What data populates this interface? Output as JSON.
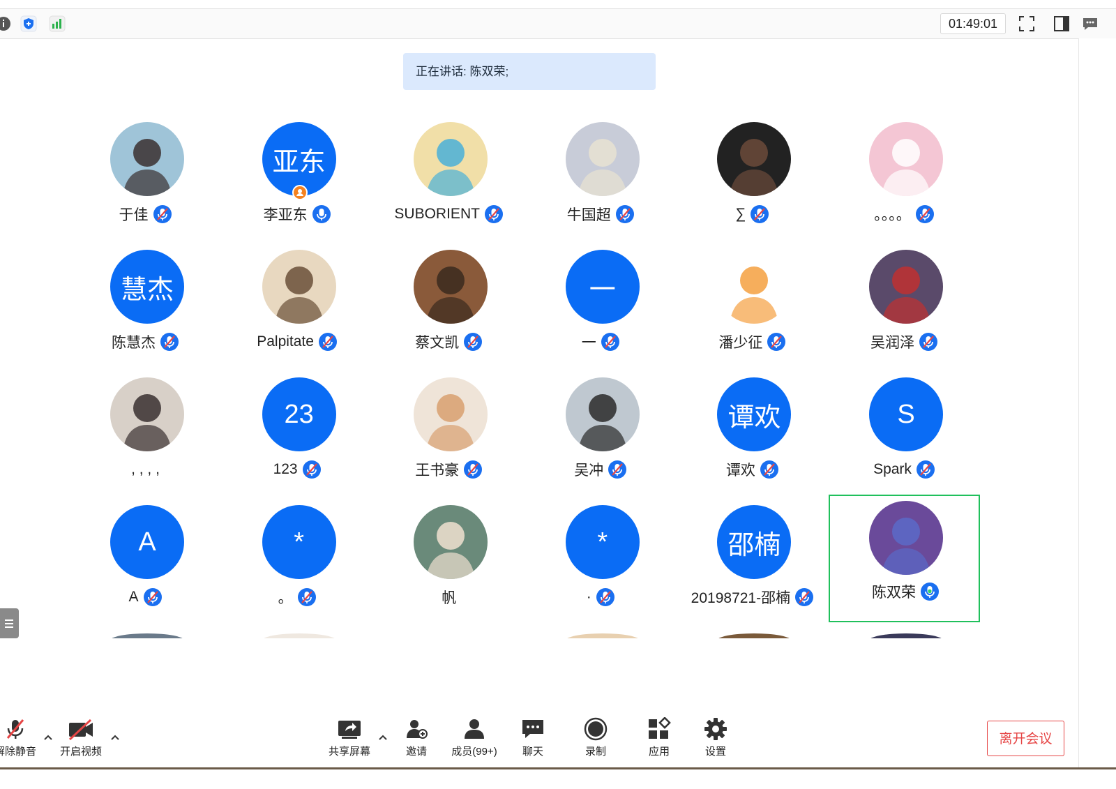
{
  "topbar": {
    "timer": "01:49:01",
    "icons": [
      "info-icon",
      "security-shield-icon",
      "signal-strength-icon",
      "fullscreen-icon",
      "side-panel-icon",
      "chat-bubble-icon"
    ]
  },
  "speaker_banner": "正在讲话: 陈双荣;",
  "participants": [
    {
      "name": "于佳",
      "avatar": "photo",
      "mic": "muted"
    },
    {
      "name": "李亚东",
      "avatar": "亚东",
      "mic": "unmuted",
      "host": true
    },
    {
      "name": "SUBORIENT",
      "avatar": "photo",
      "mic": "muted"
    },
    {
      "name": "牛国超",
      "avatar": "photo",
      "mic": "muted"
    },
    {
      "name": "∑",
      "avatar": "photo",
      "mic": "muted"
    },
    {
      "name": "。。。。",
      "avatar": "photo",
      "mic": "muted"
    },
    {
      "name": "陈慧杰",
      "avatar": "慧杰",
      "mic": "muted"
    },
    {
      "name": "Palpitate",
      "avatar": "photo",
      "mic": "muted"
    },
    {
      "name": "蔡文凯",
      "avatar": "photo",
      "mic": "muted"
    },
    {
      "name": "一",
      "avatar": "一",
      "mic": "muted"
    },
    {
      "name": "潘少征",
      "avatar": "photo",
      "mic": "muted"
    },
    {
      "name": "吴润泽",
      "avatar": "photo",
      "mic": "muted"
    },
    {
      "name": ", , , ,",
      "avatar": "photo",
      "mic": "none"
    },
    {
      "name": "123",
      "avatar": "23",
      "mic": "muted"
    },
    {
      "name": "王书豪",
      "avatar": "photo",
      "mic": "muted"
    },
    {
      "name": "吴冲",
      "avatar": "photo",
      "mic": "muted"
    },
    {
      "name": "谭欢",
      "avatar": "谭欢",
      "mic": "muted"
    },
    {
      "name": "Spark",
      "avatar": "S",
      "mic": "muted"
    },
    {
      "name": "A",
      "avatar": "A",
      "mic": "muted"
    },
    {
      "name": "。",
      "avatar": "*",
      "mic": "muted"
    },
    {
      "name": "帆",
      "avatar": "photo",
      "mic": "none"
    },
    {
      "name": "·",
      "avatar": "*",
      "mic": "muted"
    },
    {
      "name": "20198721-邵楠",
      "avatar": "邵楠",
      "mic": "muted"
    },
    {
      "name": "陈双荣",
      "avatar": "photo",
      "mic": "speaking",
      "active": true
    }
  ],
  "toolbar": {
    "unmute": "解除静音",
    "start_video": "开启视频",
    "share_screen": "共享屏幕",
    "invite": "邀请",
    "members": "成员(99+)",
    "chat": "聊天",
    "record": "录制",
    "apps": "应用",
    "settings": "设置",
    "leave": "离开会议"
  },
  "colors": {
    "accent": "#0a6cf5",
    "active_border": "#20c05c",
    "leave": "#e64545",
    "banner_bg": "#dbe9fd"
  }
}
